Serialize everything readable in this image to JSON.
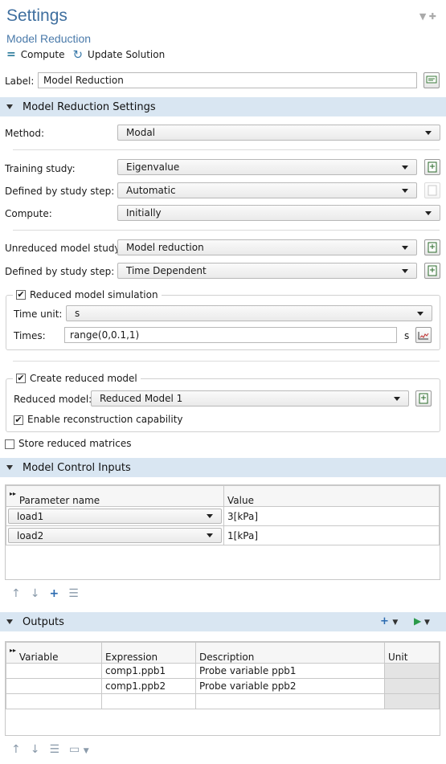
{
  "header": {
    "title": "Settings",
    "subtitle": "Model Reduction"
  },
  "toolbar": {
    "compute": "Compute",
    "update": "Update Solution"
  },
  "label_field": {
    "label": "Label:",
    "value": "Model Reduction"
  },
  "section1": {
    "title": "Model Reduction Settings",
    "method_label": "Method:",
    "method_value": "Modal",
    "training_label": "Training study:",
    "training_value": "Eigenvalue",
    "defined_label": "Defined by study step:",
    "defined_value": "Automatic",
    "compute_label": "Compute:",
    "compute_value": "Initially",
    "unreduced_label": "Unreduced model study:",
    "unreduced_value": "Model reduction",
    "defined2_label": "Defined by study step:",
    "defined2_value": "Time Dependent",
    "sim_group": "Reduced model simulation",
    "time_unit_label": "Time unit:",
    "time_unit_value": "s",
    "times_label": "Times:",
    "times_value": "range(0,0.1,1)",
    "times_unit": "s",
    "create_group": "Create reduced model",
    "reduced_label": "Reduced model:",
    "reduced_value": "Reduced Model 1",
    "enable_recon": "Enable reconstruction capability",
    "store_matrices": "Store reduced matrices"
  },
  "section2": {
    "title": "Model Control Inputs",
    "col_param": "Parameter name",
    "col_value": "Value",
    "rows": [
      {
        "param": "load1",
        "value": "3[kPa]"
      },
      {
        "param": "load2",
        "value": "1[kPa]"
      }
    ]
  },
  "section3": {
    "title": "Outputs",
    "col_var": "Variable",
    "col_expr": "Expression",
    "col_desc": "Description",
    "col_unit": "Unit",
    "rows": [
      {
        "var": "",
        "expr": "comp1.ppb1",
        "desc": "Probe variable ppb1",
        "unit": ""
      },
      {
        "var": "",
        "expr": "comp1.ppb2",
        "desc": "Probe variable ppb2",
        "unit": ""
      }
    ]
  },
  "colors": {
    "accent": "#3f6f9f",
    "section_bg": "#d9e6f2"
  }
}
